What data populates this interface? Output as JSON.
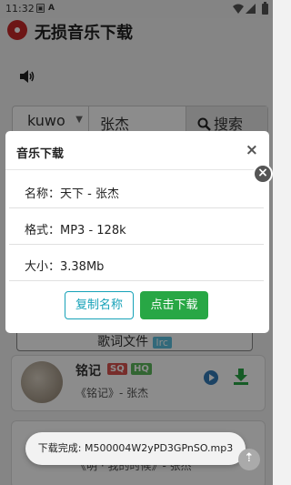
{
  "status_bar": {
    "time": "11:32"
  },
  "app": {
    "title": "无损音乐下载",
    "search": {
      "source": "kuwo",
      "keyword": "张杰",
      "button_label": "搜索"
    },
    "lyric_button": {
      "label": "歌词文件",
      "tag": "lrc"
    },
    "results": [
      {
        "title": "铭记",
        "badges": [
          "SQ",
          "HQ"
        ],
        "subtitle": "《铭记》- 张杰"
      },
      {
        "subtitle": "《明 · 我的时候》- 张杰"
      }
    ]
  },
  "modal": {
    "title": "音乐下载",
    "close_symbol": "×"
  },
  "alert": {
    "name_row": "名称：天下 - 张杰",
    "format_row": "格式：MP3 - 128k",
    "size_row": "大小：3.38Mb",
    "copy_button": "复制名称",
    "download_button": "点击下载",
    "close_symbol": "×"
  },
  "toast": {
    "text": "下载完成: M500004W2yPD3GPnSO.mp3"
  },
  "colors": {
    "copy_button": "#17a2b8",
    "download_button": "#28a745",
    "sq_badge": "#d9534f",
    "hq_badge": "#5cb85c"
  }
}
